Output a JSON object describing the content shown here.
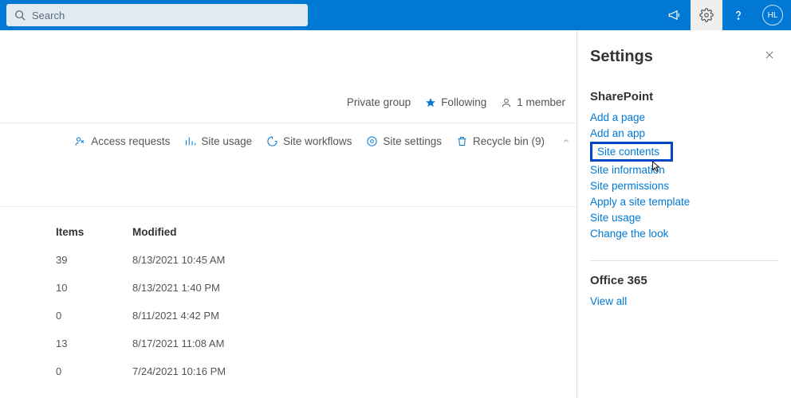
{
  "search": {
    "placeholder": "Search"
  },
  "avatar_initials": "HL",
  "info_bar": {
    "privacy": "Private group",
    "following": "Following",
    "members": "1 member"
  },
  "commands": {
    "access_requests": "Access requests",
    "site_usage": "Site usage",
    "site_workflows": "Site workflows",
    "site_settings": "Site settings",
    "recycle_bin": "Recycle bin (9)"
  },
  "table": {
    "headers": {
      "items": "Items",
      "modified": "Modified"
    },
    "rows": [
      {
        "items": "39",
        "modified": "8/13/2021 10:45 AM"
      },
      {
        "items": "10",
        "modified": "8/13/2021 1:40 PM"
      },
      {
        "items": "0",
        "modified": "8/11/2021 4:42 PM"
      },
      {
        "items": "13",
        "modified": "8/17/2021 11:08 AM"
      },
      {
        "items": "0",
        "modified": "7/24/2021 10:16 PM"
      }
    ]
  },
  "settings_panel": {
    "title": "Settings",
    "sharepoint": {
      "heading": "SharePoint",
      "links": {
        "add_page": "Add a page",
        "add_app": "Add an app",
        "site_contents": "Site contents",
        "site_information": "Site information",
        "site_permissions": "Site permissions",
        "apply_template": "Apply a site template",
        "site_usage": "Site usage",
        "change_look": "Change the look"
      }
    },
    "office365": {
      "heading": "Office 365",
      "view_all": "View all"
    }
  }
}
